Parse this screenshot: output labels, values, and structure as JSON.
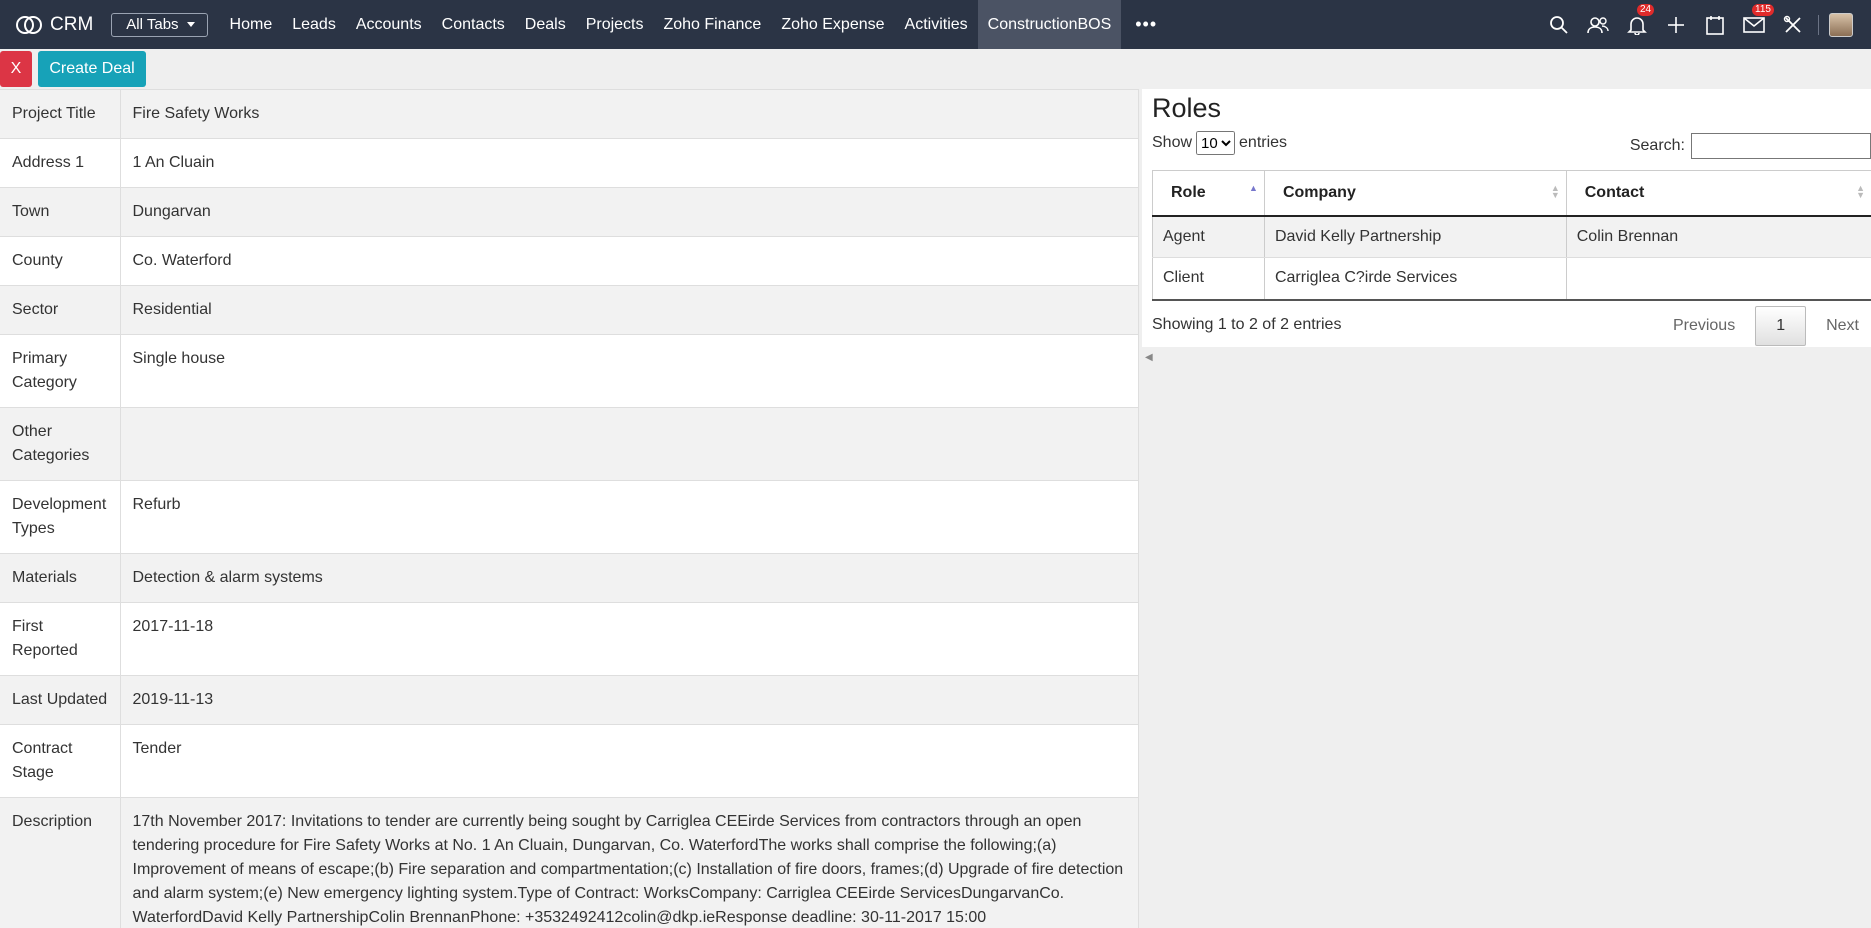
{
  "app": {
    "name": "CRM",
    "all_tabs": "All Tabs"
  },
  "nav": {
    "tabs": [
      "Home",
      "Leads",
      "Accounts",
      "Contacts",
      "Deals",
      "Projects",
      "Zoho Finance",
      "Zoho Expense",
      "Activities",
      "ConstructionBOS"
    ],
    "active_tab": "ConstructionBOS",
    "more": "•••",
    "notifications_count": "24",
    "mail_count": "115",
    "icons": [
      "search-icon",
      "contacts-icon",
      "bell-icon",
      "plus-icon",
      "calendar-icon",
      "mail-icon",
      "tools-icon",
      "avatar"
    ]
  },
  "actions": {
    "close_label": "X",
    "create_deal_label": "Create Deal"
  },
  "details": [
    {
      "label": "Project Title",
      "value": "Fire Safety Works"
    },
    {
      "label": "Address 1",
      "value": "1 An Cluain"
    },
    {
      "label": "Town",
      "value": "Dungarvan"
    },
    {
      "label": "County",
      "value": "Co. Waterford"
    },
    {
      "label": "Sector",
      "value": "Residential"
    },
    {
      "label": "Primary Category",
      "value": "Single house"
    },
    {
      "label": "Other Categories",
      "value": ""
    },
    {
      "label": "Development Types",
      "value": "Refurb"
    },
    {
      "label": "Materials",
      "value": "Detection & alarm systems"
    },
    {
      "label": "First Reported",
      "value": "2017-11-18"
    },
    {
      "label": "Last Updated",
      "value": "2019-11-13"
    },
    {
      "label": "Contract Stage",
      "value": "Tender"
    },
    {
      "label": "Description",
      "value": "17th November 2017: Invitations to tender are currently being sought by Carriglea CEEirde Services from contractors through an open tendering procedure for Fire Safety Works at No. 1 An Cluain, Dungarvan, Co. WaterfordThe works shall comprise the following;(a) Improvement of means of escape;(b) Fire separation and compartmentation;(c) Installation of fire doors, frames;(d) Upgrade of fire detection and alarm system;(e) New emergency lighting system.Type of Contract: WorksCompany: Carriglea CEEirde ServicesDungarvanCo. WaterfordDavid Kelly PartnershipColin BrennanPhone: +3532492412colin@dkp.ieResponse deadline: 30-11-2017 15:00"
    }
  ],
  "roles": {
    "title": "Roles",
    "show_label": "Show",
    "entries_label": "entries",
    "page_size": "10",
    "search_label": "Search:",
    "search_value": "",
    "columns": [
      "Role",
      "Company",
      "Contact"
    ],
    "rows": [
      [
        "Agent",
        "David Kelly Partnership",
        "Colin Brennan"
      ],
      [
        "Client",
        "Carriglea C?irde Services",
        ""
      ]
    ],
    "info": "Showing 1 to 2 of 2 entries",
    "previous": "Previous",
    "current_page": "1",
    "next": "Next"
  }
}
